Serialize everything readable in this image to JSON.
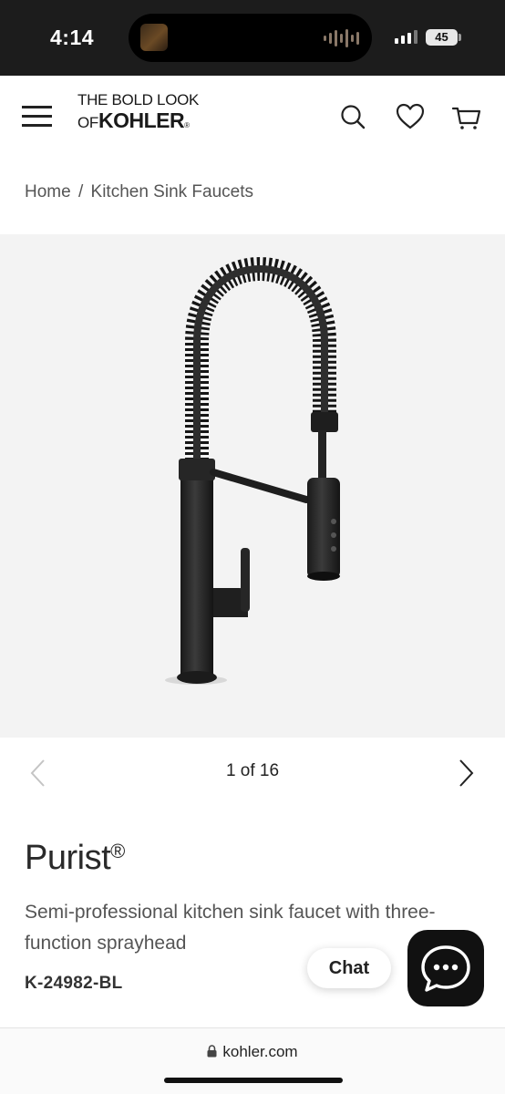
{
  "status_bar": {
    "time": "4:14",
    "battery": "45"
  },
  "header": {
    "logo_line1": "THE BOLD LOOK",
    "logo_of": "OF",
    "logo_brand": "KOHLER",
    "logo_reg": "®",
    "icons": [
      "menu-icon",
      "search-icon",
      "heart-icon",
      "cart-icon"
    ]
  },
  "breadcrumb": {
    "items": [
      "Home",
      "Kitchen Sink Faucets"
    ],
    "separator": "/"
  },
  "gallery": {
    "counter": "1 of 16",
    "current": 1,
    "total": 16
  },
  "product": {
    "name": "Purist",
    "reg": "®",
    "description": "Semi-professional kitchen sink faucet with three-function sprayhead",
    "sku": "K-24982-BL"
  },
  "chat": {
    "label": "Chat"
  },
  "browser": {
    "url": "kohler.com"
  },
  "colors": {
    "status_bar_bg": "#1c1c1c",
    "gallery_bg": "#f3f3f3",
    "chat_button_bg": "#111111",
    "text_primary": "#222222",
    "text_secondary": "#555555"
  }
}
